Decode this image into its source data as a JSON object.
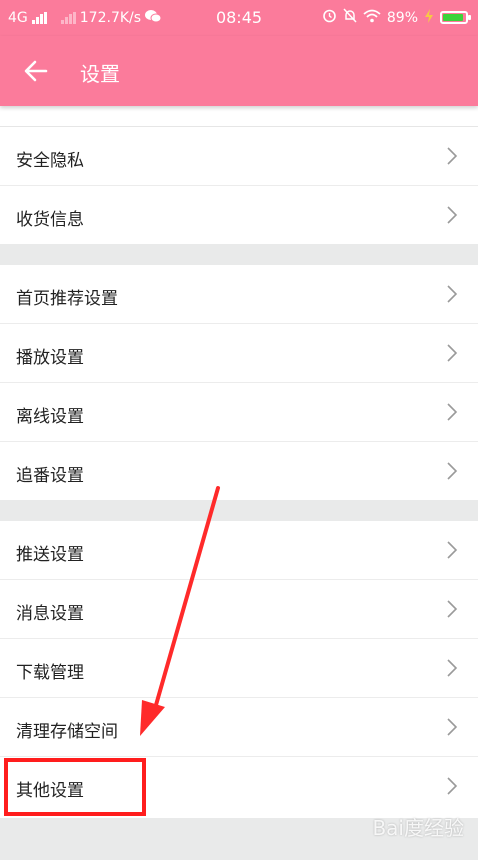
{
  "status_bar": {
    "network": "4G",
    "speed": "172.7K/s",
    "time": "08:45",
    "battery": "89%",
    "battery_level": 0.89,
    "colors": {
      "bar_bg": "#fb7b9b",
      "battery_fill": "#3ad33a"
    }
  },
  "header": {
    "title": "设置",
    "back_icon": "arrow-left-icon",
    "color": "#fb7b9b"
  },
  "groups": [
    {
      "items": [
        {
          "label": "安全隐私"
        },
        {
          "label": "收货信息"
        }
      ]
    },
    {
      "items": [
        {
          "label": "首页推荐设置"
        },
        {
          "label": "播放设置"
        },
        {
          "label": "离线设置"
        },
        {
          "label": "追番设置"
        }
      ]
    },
    {
      "items": [
        {
          "label": "推送设置"
        },
        {
          "label": "消息设置"
        },
        {
          "label": "下载管理"
        },
        {
          "label": "清理存储空间"
        },
        {
          "label": "其他设置"
        }
      ]
    }
  ],
  "annotation": {
    "highlight_color": "#ff1d1d",
    "target": "其他设置"
  },
  "watermark": {
    "text": "Bai度经验"
  }
}
